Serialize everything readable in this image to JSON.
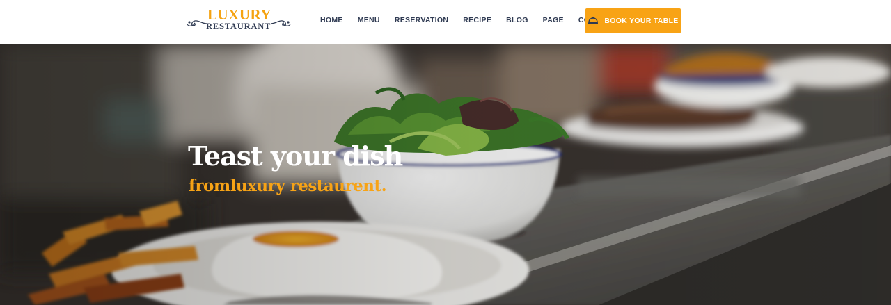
{
  "logo": {
    "line1": "LUXURY",
    "line2": "RESTAURANT"
  },
  "nav": {
    "items": [
      {
        "label": "HOME"
      },
      {
        "label": "MENU"
      },
      {
        "label": "RESERVATION"
      },
      {
        "label": "RECIPE"
      },
      {
        "label": "BLOG"
      },
      {
        "label": "PAGE"
      },
      {
        "label": "CONTACT"
      }
    ],
    "cta_label": "BOOK YOUR TABLE",
    "cta_icon": "cloche-icon"
  },
  "hero": {
    "title": "Teast your dish",
    "subtitle": "fromluxury restaurent."
  },
  "colors": {
    "accent": "#f8a315",
    "nav_text": "#2f3a52",
    "header_bg": "#ffffff",
    "hero_title": "#ffffff",
    "hero_subtitle": "#f7a316"
  }
}
